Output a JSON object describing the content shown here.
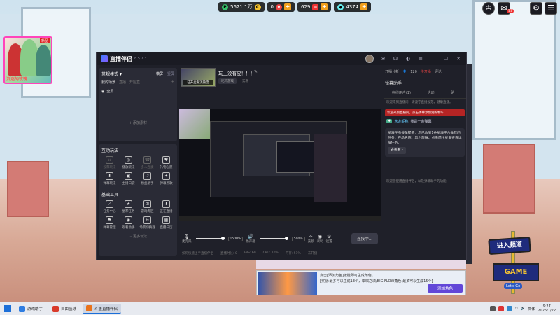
{
  "hud": {
    "points": "5621.1万",
    "zero": "0",
    "gems": "629",
    "tickets": "4374"
  },
  "top_right": {
    "gift_badge": "99"
  },
  "avatar_card": {
    "tag": "新品",
    "name": "沉迷的玫瑰"
  },
  "app": {
    "title": "直播伴侣",
    "version": "8.5.7.3",
    "left": {
      "mode": "常规模式",
      "mode_links": [
        "横屏",
        "竖屏"
      ],
      "scene_tabs": [
        "我的场景",
        "直播",
        "开始直"
      ],
      "scene_item": "全屏",
      "add_source": "+ 添加素材",
      "interact_title": "互动玩法",
      "interact_tools": [
        {
          "label": "投票玩法",
          "icon": "☷",
          "dim": true
        },
        {
          "label": "播放玩法",
          "icon": "◎",
          "dim": false
        },
        {
          "label": "多人连麦",
          "icon": "☎",
          "dim": true
        },
        {
          "label": "礼物心愿",
          "icon": "♥",
          "dim": false
        },
        {
          "label": "弹幕玩法",
          "icon": "⬇",
          "dim": false
        },
        {
          "label": "主播口袋",
          "icon": "▣",
          "dim": false
        },
        {
          "label": "粉丝助手",
          "icon": "♡",
          "dim": false
        },
        {
          "label": "弹幕点歌",
          "icon": "✦",
          "dim": false
        }
      ],
      "basic_title": "基础工具",
      "basic_tools": [
        {
          "label": "任务中心",
          "icon": "✓",
          "dim": false
        },
        {
          "label": "星荐任务",
          "icon": "★",
          "dim": false
        },
        {
          "label": "游戏专区",
          "icon": "⊞",
          "dim": false
        },
        {
          "label": "正在直播",
          "icon": "⬇",
          "dim": false
        },
        {
          "label": "弹幕管理",
          "icon": "⚑",
          "dim": false
        },
        {
          "label": "观看助手",
          "icon": "◉",
          "dim": false
        },
        {
          "label": "场景切换器",
          "icon": "⇆",
          "dim": false
        },
        {
          "label": "直播日历",
          "icon": "▦",
          "dim": false
        }
      ],
      "more": "··· 更多玩法"
    },
    "center": {
      "cover_text": "已开启限流热度",
      "room_title": "玩上没有皮！！！",
      "category": "吃鸡游戏",
      "room_id": "实况",
      "controls": {
        "mic": "麦克风",
        "mic_pct": "1500%",
        "speaker": "扬声器",
        "speaker_pct": "500%",
        "effects": "美颜",
        "record": "录制",
        "settings": "设置",
        "connect": "连接中..."
      },
      "stats": [
        "如何快速上手直播伴侣",
        "直播时长: 0",
        "FPS: 60",
        "CPU: 10%",
        "内存: 51%",
        "未开播"
      ]
    },
    "right": {
      "top": [
        "开播分析",
        "分享",
        "全屏",
        "评论"
      ],
      "viewers": "120",
      "live": "待开播",
      "title": "弹幕助手",
      "tabs": [
        "在线用户(1)",
        "活动",
        "贴士"
      ],
      "msg1": "欢迎来到直播间！请遵守直播规范，健康直播。",
      "red_danmaku": "欢迎来到直播间，点击弹幕添加到购物车",
      "user": "水友昵称",
      "user_msg": "我是一条弹幕",
      "card": "星海任务接单提醒：您已收到1条星海平台推荐的任务，产品名称：风之旅舞，点击前往星海查看详细任务。",
      "see": "去查看 ›",
      "msg2": "欢迎您使用直播伴侣，以及弹幕助手的功能"
    }
  },
  "banner": {
    "line1": "点击[添加角色]按键即可生成角色。",
    "line2": "[奖励:最多可以生成13个，琪琪之歌/BIG FLOW角色:最多可以生成15个]",
    "button": "添加角色"
  },
  "sign": {
    "top": "进入频道",
    "game": "GAME",
    "sub": "Let's Go"
  },
  "taskbar": {
    "apps": [
      {
        "label": "游戏助手",
        "color": "#2f7de1",
        "active": false
      },
      {
        "label": "自由篮球",
        "color": "#d93b2b",
        "active": false
      },
      {
        "label": "斗鱼直播伴侣",
        "color": "#e9731c",
        "active": true
      }
    ],
    "lang": "简体",
    "time": "9:27",
    "date": "2026/1/22"
  }
}
